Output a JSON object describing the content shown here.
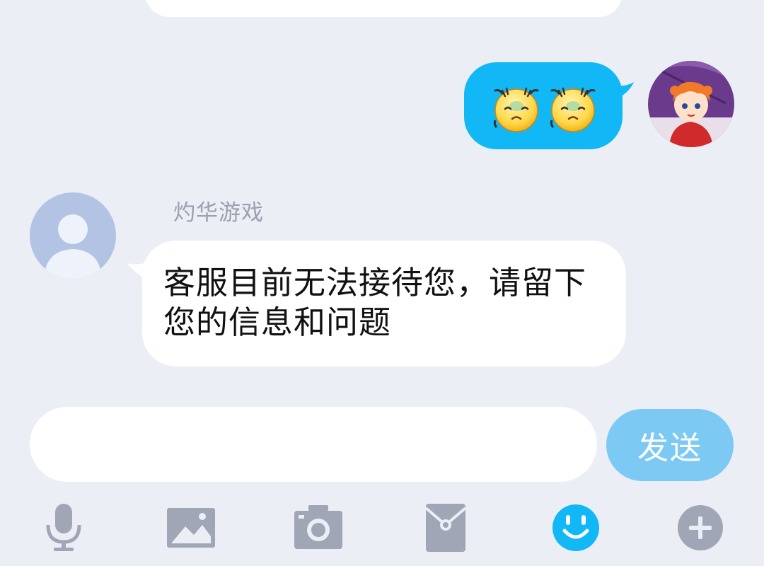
{
  "outgoing_message": {
    "emojis": [
      "sweat-face-emoji",
      "sweat-face-emoji"
    ],
    "bubble_color": "#12b7f5"
  },
  "incoming_message": {
    "sender_name": "灼华游戏",
    "text": "客服目前无法接待您，请留下您的信息和问题"
  },
  "composer": {
    "input_value": "",
    "send_label": "发送",
    "send_color": "#7ccaf4"
  },
  "toolbar": {
    "items": [
      "microphone-icon",
      "image-icon",
      "camera-icon",
      "red-packet-icon",
      "emoji-icon",
      "plus-icon"
    ],
    "active_color": "#12b7f5",
    "icon_color": "#a0a6b6"
  }
}
